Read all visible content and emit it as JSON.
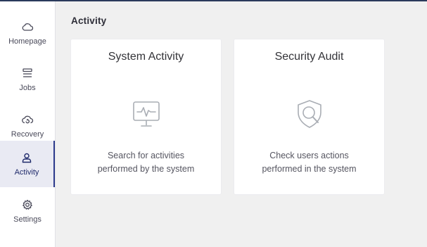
{
  "sidebar": {
    "items": [
      {
        "label": "Homepage",
        "icon": "cloud-icon",
        "active": false
      },
      {
        "label": "Jobs",
        "icon": "stack-icon",
        "active": false
      },
      {
        "label": "Recovery",
        "icon": "cloud-restore-icon",
        "active": false
      },
      {
        "label": "Activity",
        "icon": "user-icon",
        "active": true
      },
      {
        "label": "Settings",
        "icon": "gear-icon",
        "active": false
      }
    ]
  },
  "main": {
    "title": "Activity",
    "cards": [
      {
        "title": "System Activity",
        "icon": "monitor-pulse-icon",
        "desc_line1": "Search for activities",
        "desc_line2": "performed by the system"
      },
      {
        "title": "Security Audit",
        "icon": "shield-search-icon",
        "desc_line1": "Check users actions",
        "desc_line2": "performed in the system"
      }
    ]
  },
  "colors": {
    "accent": "#2c3a8c",
    "active_bg": "#e9eaf3",
    "topbar": "#2a3a5c",
    "page_bg": "#f0f0f0",
    "icon_gray": "#a9adb4"
  }
}
